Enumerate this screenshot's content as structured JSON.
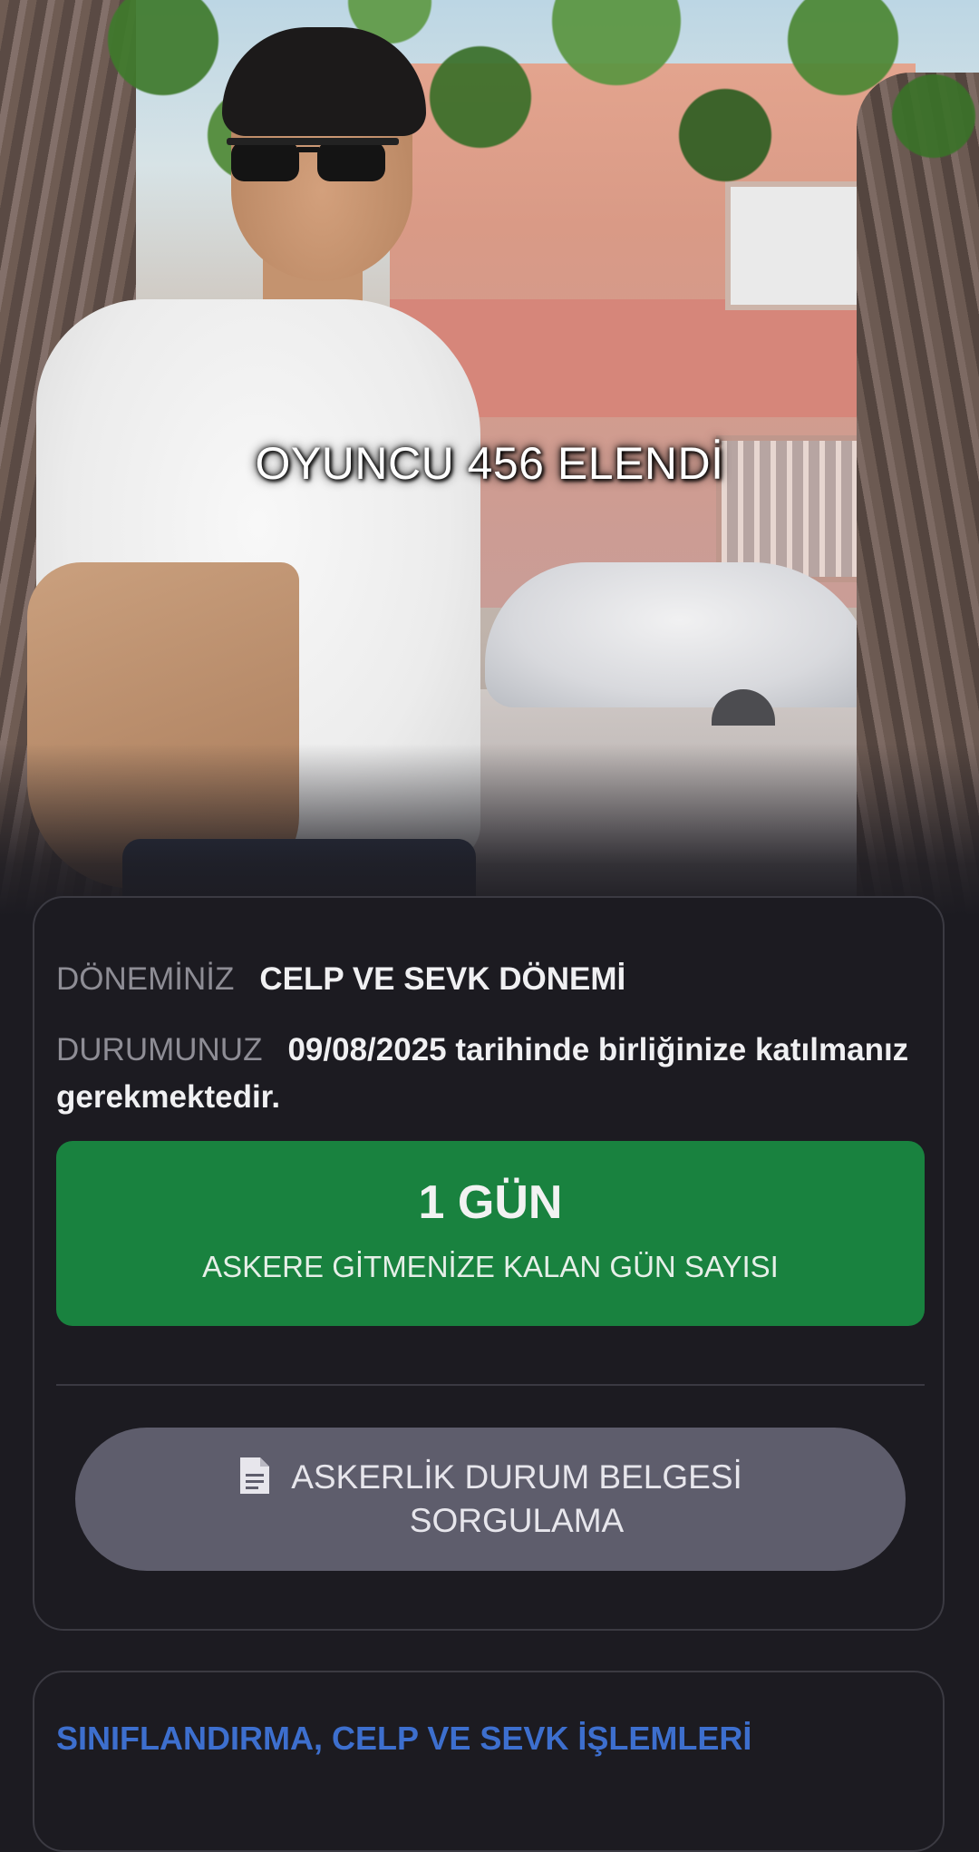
{
  "video_caption": "OYUNCU 456 ELENDİ",
  "status_card": {
    "period_label": "DÖNEMİNİZ",
    "period_value": "CELP VE SEVK DÖNEMİ",
    "status_label": "DURUMUNUZ",
    "status_value": "09/08/2025 tarihinde birliğinize katılmanız gerekmektedir.",
    "countdown_value": "1 GÜN",
    "countdown_caption": "ASKERE GİTMENİZE KALAN GÜN SAYISI",
    "query_button_line1": "ASKERLİK DURUM BELGESİ",
    "query_button_line2": "SORGULAMA",
    "query_button_icon": "document-icon"
  },
  "next_card": {
    "title": "SINIFLANDIRMA, CELP VE SEVK İŞLEMLERİ"
  },
  "colors": {
    "background": "#1c1b21",
    "countdown_green": "#19823f",
    "button_gray": "#5e5d6c",
    "link_blue": "#3d6fce"
  }
}
